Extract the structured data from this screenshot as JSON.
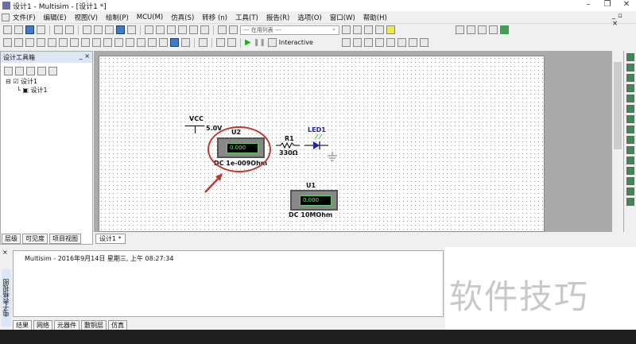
{
  "window": {
    "title": "设计1 - Multisim - [设计1 *]",
    "min": "–",
    "restore": "❐",
    "close": "✕"
  },
  "menu": [
    "文件(F)",
    "编辑(E)",
    "视图(V)",
    "绘制(P)",
    "MCU(M)",
    "仿真(S)",
    "转移 (n)",
    "工具(T)",
    "报告(R)",
    "选项(O)",
    "窗口(W)",
    "帮助(H)"
  ],
  "mdi_controls": "_ ▫ ×",
  "toolbar": {
    "dropdown": "--- 在用列表 ---",
    "interactive": "Interactive"
  },
  "left_panel": {
    "title": "设计工具箱",
    "tree": [
      "设计1",
      "设计1"
    ],
    "tabs": [
      "层级",
      "可见度",
      "项目视图"
    ]
  },
  "canvas_tab": "设计1 *",
  "schematic": {
    "vcc": "VCC",
    "vcc_value": "5.0V",
    "u2": "U2",
    "u2_display": "0.000",
    "u2_value": "DC  1e-009Ohm",
    "r1": "R1",
    "r1_value": "330Ω",
    "led": "LED1",
    "u1": "U1",
    "u1_display": "0.000",
    "u1_value": "DC  10MOhm",
    "highlight_color": "#c0392b"
  },
  "bottom": {
    "side_label": "电子表格视图",
    "log": "Multisim  -  2016年9月14日 星期三, 上午 08:27:34",
    "tabs": [
      "结果",
      "网络",
      "元器件",
      "敷铜层",
      "仿真"
    ]
  },
  "watermark": "软件技巧"
}
